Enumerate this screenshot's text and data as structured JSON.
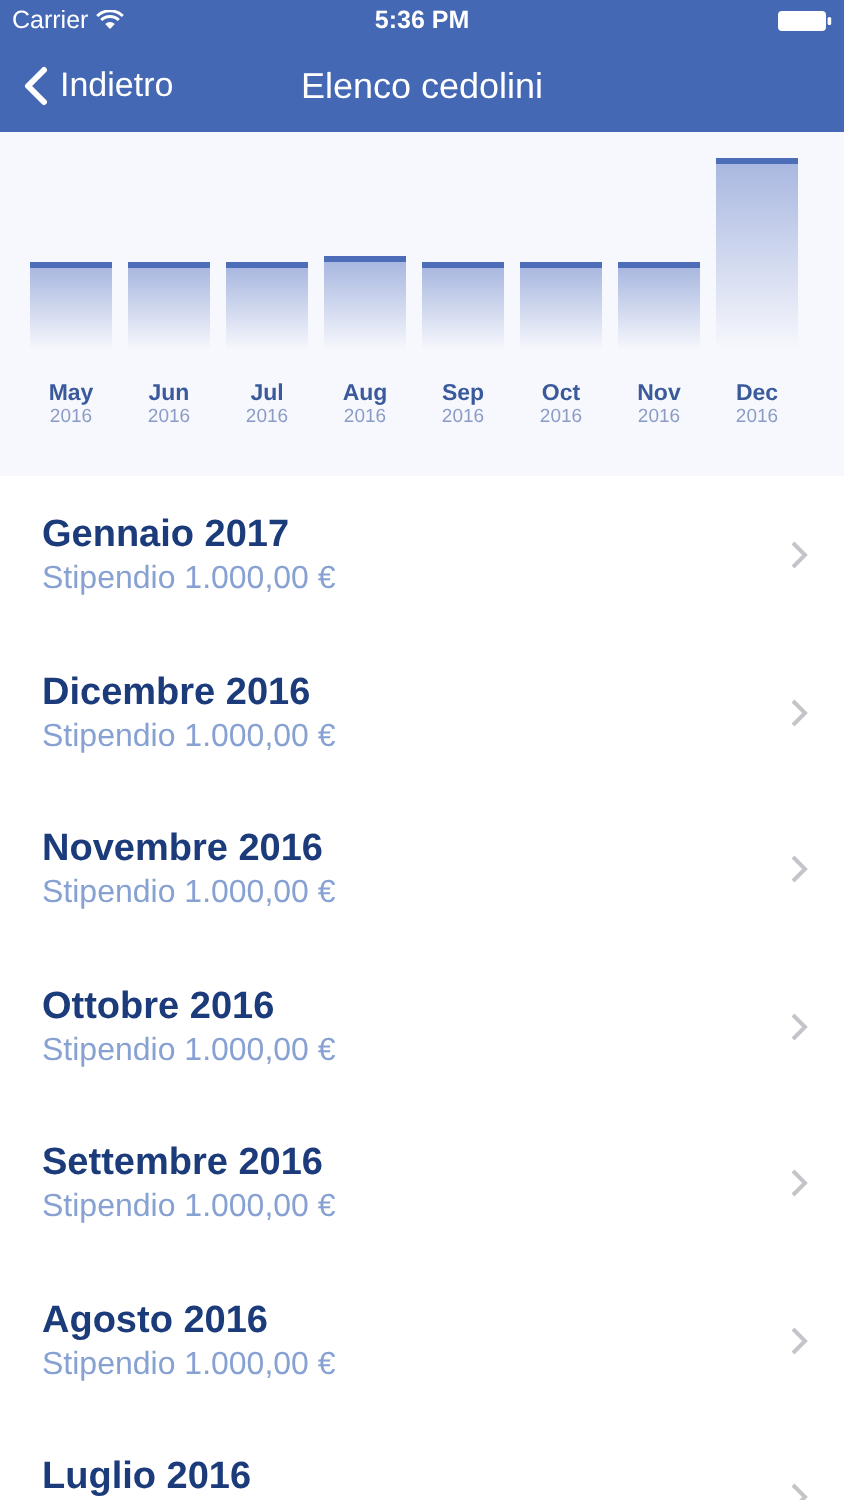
{
  "status_bar": {
    "carrier": "Carrier",
    "time": "5:36 PM"
  },
  "nav_bar": {
    "back": "Indietro",
    "title": "Elenco cedolini"
  },
  "chart": {
    "bars": [
      {
        "month": "May",
        "year": "2016"
      },
      {
        "month": "Jun",
        "year": "2016"
      },
      {
        "month": "Jul",
        "year": "2016"
      },
      {
        "month": "Aug",
        "year": "2016"
      },
      {
        "month": "Sep",
        "year": "2016"
      },
      {
        "month": "Oct",
        "year": "2016"
      },
      {
        "month": "Nov",
        "year": "2016"
      },
      {
        "month": "Dec",
        "year": "2016"
      }
    ]
  },
  "payslips": [
    {
      "title": "Gennaio 2017",
      "subtitle": "Stipendio 1.000,00 €"
    },
    {
      "title": "Dicembre 2016",
      "subtitle": "Stipendio 1.000,00 €"
    },
    {
      "title": "Novembre 2016",
      "subtitle": "Stipendio 1.000,00 €"
    },
    {
      "title": "Ottobre 2016",
      "subtitle": "Stipendio 1.000,00 €"
    },
    {
      "title": "Settembre 2016",
      "subtitle": "Stipendio 1.000,00 €"
    },
    {
      "title": "Agosto 2016",
      "subtitle": "Stipendio 1.000,00 €"
    },
    {
      "title": "Luglio 2016"
    }
  ]
}
